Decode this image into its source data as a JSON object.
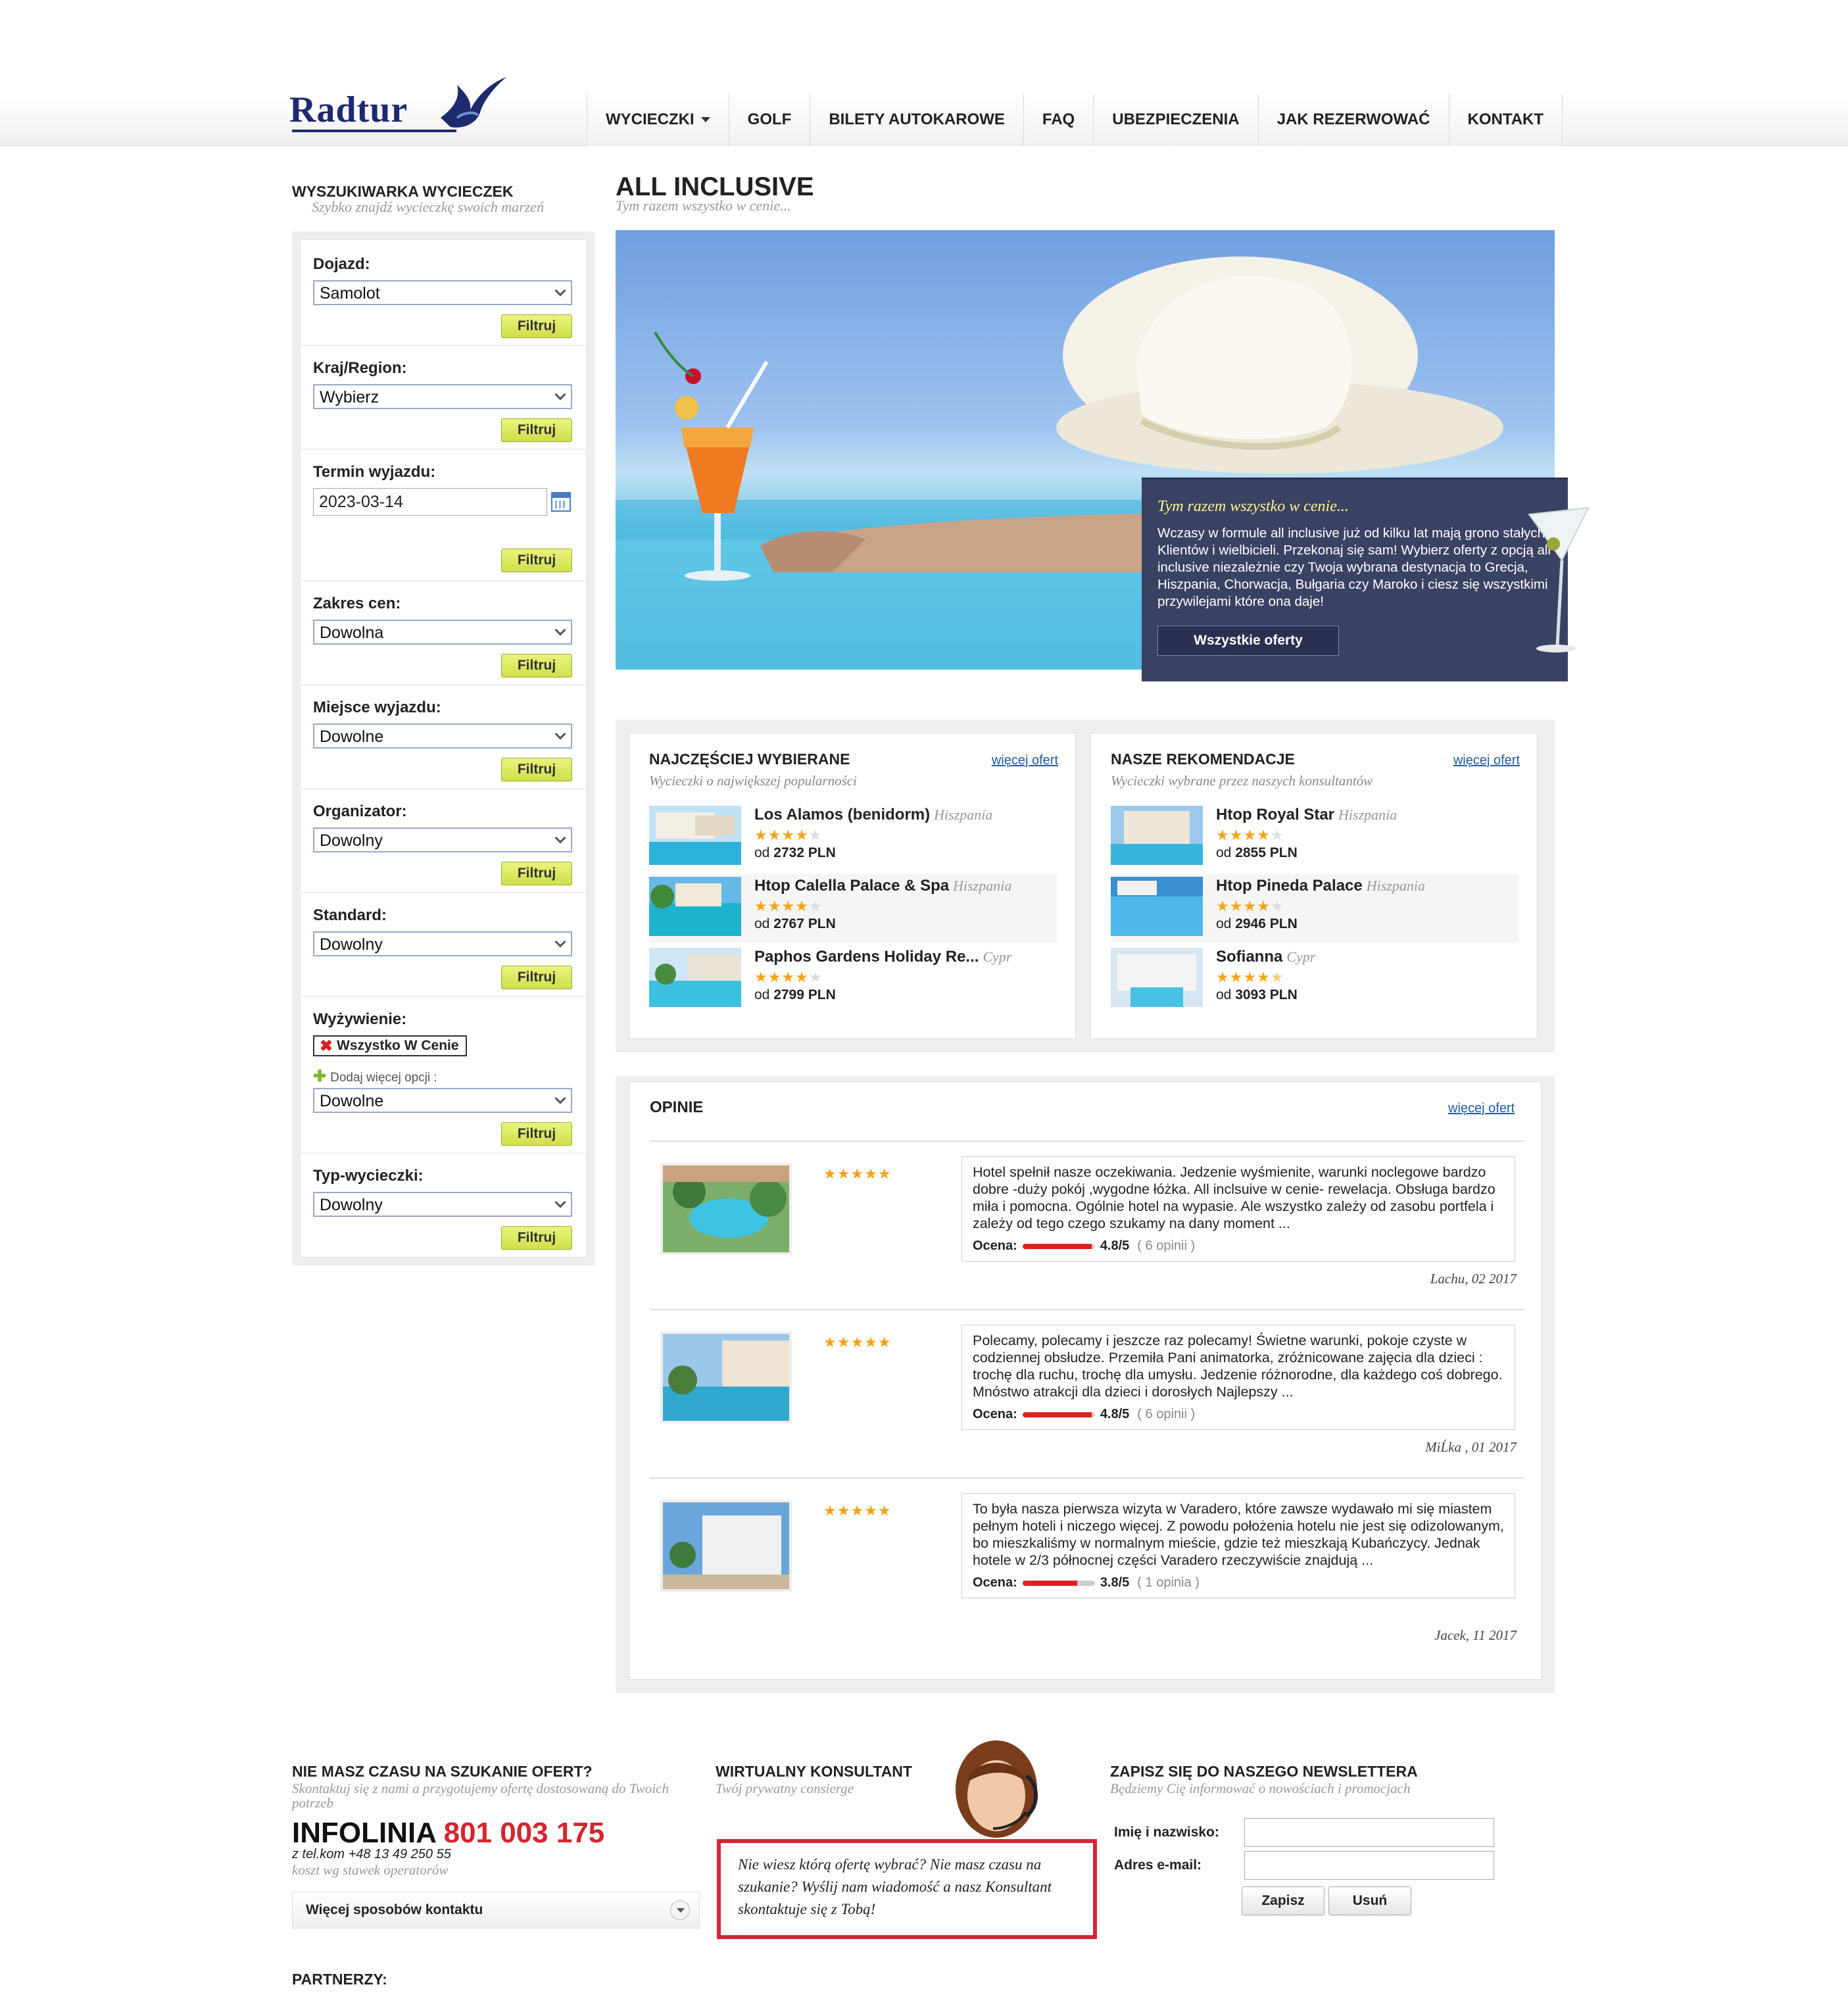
{
  "header": {
    "logo_text": "Radtur",
    "nav": [
      {
        "label": "WYCIECZKI"
      },
      {
        "label": "GOLF"
      },
      {
        "label": "BILETY AUTOKAROWE"
      },
      {
        "label": "FAQ"
      },
      {
        "label": "UBEZPIECZENIA"
      },
      {
        "label": "JAK REZERWOWAĆ"
      },
      {
        "label": "KONTAKT"
      }
    ]
  },
  "sidebar": {
    "title": "WYSZUKIWARKA WYCIECZEK",
    "subtitle": "Szybko znajdź wycieczkę swoich marzeń",
    "button_label": "Filtruj",
    "filters": {
      "dojazd": {
        "label": "Dojazd:",
        "value": "Samolot"
      },
      "kraj": {
        "label": "Kraj/Region:",
        "value": "Wybierz"
      },
      "termin": {
        "label": "Termin wyjazdu:",
        "value": "2023-03-14"
      },
      "ceny": {
        "label": "Zakres cen:",
        "value": "Dowolna"
      },
      "miejsce": {
        "label": "Miejsce wyjazdu:",
        "value": "Dowolne"
      },
      "organizator": {
        "label": "Organizator:",
        "value": "Dowolny"
      },
      "standard": {
        "label": "Standard:",
        "value": "Dowolny"
      },
      "wyzywienie": {
        "label": "Wyżywienie:",
        "chip": "Wszystko W Cenie",
        "add_more": "Dodaj więcej opcji :",
        "value": "Dowolne"
      },
      "typ": {
        "label": "Typ-wycieczki:",
        "value": "Dowolny"
      }
    }
  },
  "main": {
    "title": "ALL INCLUSIVE",
    "subtitle": "Tym razem wszystko w cenie...",
    "promo": {
      "title": "Tym razem wszystko w cenie...",
      "text": "Wczasy w formule all inclusive już od kilku lat mają grono stałych Klientów i wielbicieli. Przekonaj się sam! Wybierz oferty z opcją all inclusive niezależnie czy Twoja wybrana destynacja to Grecja, Hiszpania, Chorwacja, Bułgaria czy Maroko i ciesz się wszystkimi przywilejami które ona daje!",
      "button": "Wszystkie oferty"
    }
  },
  "popular": {
    "title": "NAJCZĘŚCIEJ WYBIERANE",
    "subtitle": "Wycieczki o największej popularności",
    "more": "więcej ofert",
    "price_prefix": "od",
    "items": [
      {
        "name": "Los Alamos (benidorm)",
        "country": "Hiszpania",
        "stars": 4,
        "price": "2732 PLN"
      },
      {
        "name": "Htop Calella Palace & Spa",
        "country": "Hiszpania",
        "stars": 4,
        "price": "2767 PLN"
      },
      {
        "name": "Paphos Gardens Holiday Re...",
        "country": "Cypr",
        "stars": 4,
        "price": "2799 PLN"
      }
    ]
  },
  "recommended": {
    "title": "NASZE REKOMENDACJE",
    "subtitle": "Wycieczki wybrane przez naszych konsultantów",
    "more": "więcej ofert",
    "price_prefix": "od",
    "items": [
      {
        "name": "Htop Royal Star",
        "country": "Hiszpania",
        "stars": 4,
        "price": "2855 PLN"
      },
      {
        "name": "Htop Pineda Palace",
        "country": "Hiszpania",
        "stars": 4,
        "price": "2946 PLN"
      },
      {
        "name": "Sofianna",
        "country": "Cypr",
        "stars": 4.5,
        "price": "3093 PLN"
      }
    ]
  },
  "opinions": {
    "title": "OPINIE",
    "more": "więcej ofert",
    "rating_label": "Ocena:",
    "items": [
      {
        "text": "Hotel spełnił nasze oczekiwania. Jedzenie wyśmienite, warunki noclegowe bardzo dobre -duży pokój ,wygodne łóżka. All inclsuive w cenie- rewelacja. Obsługa bardzo miła i pomocna. Ogólnie hotel na wypasie. Ale wszystko zależy od zasobu portfela i zależy od tego czego szukamy na dany moment ...",
        "score": "4.8/5",
        "score_value": 4.8,
        "count": "( 6 opinii )",
        "author": "Lachu, 02 2017"
      },
      {
        "text": "Polecamy, polecamy i jeszcze raz polecamy! Świetne warunki, pokoje czyste w codziennej obsłudze. Przemiła Pani animatorka, zróżnicowane zajęcia dla dzieci : trochę dla ruchu, trochę dla umysłu. Jedzenie różnorodne, dla każdego coś dobrego. Mnóstwo atrakcji dla dzieci i dorosłych Najlepszy ...",
        "score": "4.8/5",
        "score_value": 4.8,
        "count": "( 6 opinii )",
        "author": "MiĹka , 01 2017"
      },
      {
        "text": "To była nasza pierwsza wizyta w Varadero, które zawsze wydawało mi się miastem pełnym hoteli i niczego więcej. Z powodu położenia hotelu nie jest się odizolowanym, bo mieszkaliśmy w normalnym mieście, gdzie też mieszkają Kubańczycy. Jednak hotele w 2/3 północnej części Varadero rzeczywiście znajdują ...",
        "score": "3.8/5",
        "score_value": 3.8,
        "count": "( 1 opinia )",
        "author": "Jacek, 11 2017"
      }
    ]
  },
  "footer": {
    "contact": {
      "title": "NIE MASZ CZASU NA SZUKANIE OFERT?",
      "subtitle": "Skontaktuj się z nami a przygotujemy ofertę dostosowaną do Twoich potrzeb",
      "infolinia_label": "INFOLINIA",
      "phone": "801 003 175",
      "tel_note": "z tel.kom +48 13 49 250 55",
      "cost_note": "koszt wg stawek operatorów",
      "dropdown": "Więcej sposobów kontaktu"
    },
    "consultant": {
      "title": "WIRTUALNY KONSULTANT",
      "subtitle": "Twój prywatny consierge",
      "bubble": "Nie wiesz którą ofertę wybrać? Nie masz czasu na szukanie? Wyślij nam wiadomość a nasz Konsultant skontaktuje się z Tobą!"
    },
    "newsletter": {
      "title": "ZAPISZ SIĘ DO NASZEGO NEWSLETTERA",
      "subtitle": "Będziemy Cię informować o nowościach i promocjach",
      "name_label": "Imię i nazwisko:",
      "email_label": "Adres e-mail:",
      "subscribe": "Zapisz",
      "remove": "Usuń"
    },
    "partners_title": "PARTNERZY:"
  },
  "colors": {
    "accent_red": "#d22630",
    "link_blue": "#245aa8",
    "filter_button": "#d8e65a",
    "promo_bg": "#3a4264",
    "star": "#f2a318"
  }
}
